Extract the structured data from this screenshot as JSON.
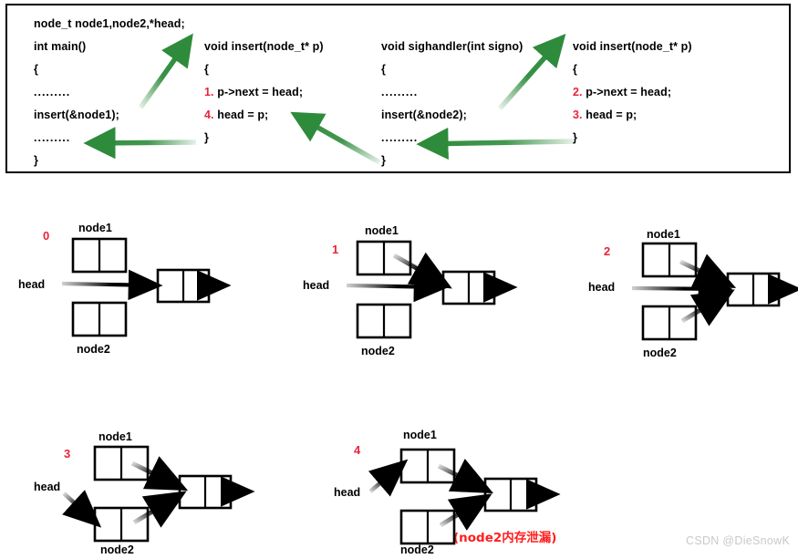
{
  "figure": {
    "watermark": "CSDN @DieSnowK"
  },
  "code_box": {
    "columns": [
      {
        "name": "main",
        "lines": [
          {
            "step": "",
            "text": "node_t node1,node2,*head;"
          },
          {
            "step": "",
            "text": "int main()"
          },
          {
            "step": "",
            "text": "{"
          },
          {
            "step": "",
            "text": "........."
          },
          {
            "step": "",
            "text": "insert(&node1);"
          },
          {
            "step": "",
            "text": "........."
          },
          {
            "step": "",
            "text": "}"
          }
        ]
      },
      {
        "name": "insert-first",
        "lines": [
          {
            "step": "",
            "text": "void insert(node_t* p)"
          },
          {
            "step": "",
            "text": "{"
          },
          {
            "step": "1.",
            "text": "p->next = head;"
          },
          {
            "step": "4.",
            "text": "head = p;"
          },
          {
            "step": "",
            "text": "}"
          }
        ]
      },
      {
        "name": "sighandler",
        "lines": [
          {
            "step": "",
            "text": "void sighandler(int signo)"
          },
          {
            "step": "",
            "text": "{"
          },
          {
            "step": "",
            "text": "........."
          },
          {
            "step": "",
            "text": "insert(&node2);"
          },
          {
            "step": "",
            "text": "........."
          },
          {
            "step": "",
            "text": "}"
          }
        ]
      },
      {
        "name": "insert-second",
        "lines": [
          {
            "step": "",
            "text": "void insert(node_t* p)"
          },
          {
            "step": "",
            "text": "{"
          },
          {
            "step": "2.",
            "text": "p->next = head;"
          },
          {
            "step": "3.",
            "text": "head = p;"
          },
          {
            "step": "",
            "text": "}"
          }
        ]
      }
    ],
    "flow_arrow_color": "#2E8B3C"
  },
  "states": [
    {
      "index": "0",
      "head_label": "head",
      "node1_label": "node1",
      "node2_label": "node2",
      "note": ""
    },
    {
      "index": "1",
      "head_label": "head",
      "node1_label": "node1",
      "node2_label": "node2",
      "note": ""
    },
    {
      "index": "2",
      "head_label": "head",
      "node1_label": "node1",
      "node2_label": "node2",
      "note": ""
    },
    {
      "index": "3",
      "head_label": "head",
      "node1_label": "node1",
      "node2_label": "node2",
      "note": ""
    },
    {
      "index": "4",
      "head_label": "head",
      "node1_label": "node1",
      "node2_label": "node2",
      "note": "(node2内存泄漏)"
    }
  ],
  "colors": {
    "step_red": "#E8253A",
    "arrow_green": "#2E8B3C",
    "leak_red": "#FF1E1E",
    "node_stroke": "#000000",
    "watermark": "#c9c9c9"
  }
}
